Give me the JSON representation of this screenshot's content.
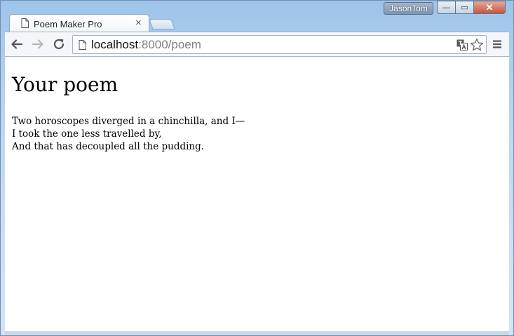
{
  "window": {
    "user_name": "JasonTom",
    "controls": {
      "minimize_glyph": "—",
      "maximize_glyph": "▭",
      "close_glyph": "✕"
    }
  },
  "tab": {
    "title": "Poem Maker Pro",
    "close_glyph": "×",
    "icon": "document-icon"
  },
  "toolbar": {
    "url_host": "localhost",
    "url_rest": ":8000/poem",
    "icons": [
      "back-arrow-icon",
      "forward-arrow-icon",
      "reload-icon",
      "page-icon",
      "translate-icon",
      "star-icon",
      "menu-icon"
    ]
  },
  "page": {
    "heading": "Your poem",
    "poem_lines": [
      "Two horoscopes diverged in a chinchilla, and I—",
      "I took the one less travelled by,",
      "And that has decoupled all the pudding."
    ]
  }
}
